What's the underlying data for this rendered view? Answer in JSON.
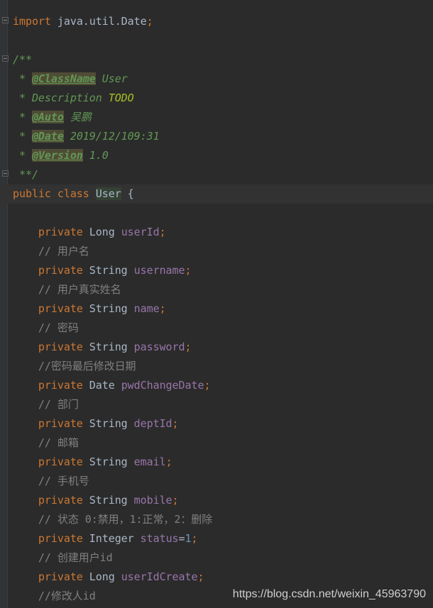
{
  "editor": {
    "theme_colors": {
      "background": "#2b2b2b",
      "keyword": "#cc7832",
      "field": "#9876aa",
      "comment": "#808080",
      "javadoc": "#629755",
      "todo": "#a8c023",
      "text": "#a9b7c6"
    },
    "current_line": 9,
    "fold_lines": [
      0,
      2,
      8
    ],
    "lines": [
      [
        [
          "kw",
          "import"
        ],
        [
          "pl",
          " java.util.Date"
        ],
        [
          "kw",
          ";"
        ]
      ],
      [],
      [
        [
          "jd",
          "/**"
        ]
      ],
      [
        [
          "jd",
          " * "
        ],
        [
          "tag",
          "@ClassName"
        ],
        [
          "jd",
          " User"
        ]
      ],
      [
        [
          "jd",
          " * Description "
        ],
        [
          "todo",
          "TODO"
        ]
      ],
      [
        [
          "jd",
          " * "
        ],
        [
          "tag",
          "@Auto"
        ],
        [
          "jd",
          " 吴鹏"
        ]
      ],
      [
        [
          "jd",
          " * "
        ],
        [
          "tag",
          "@Date"
        ],
        [
          "jd",
          " 2019/12/109:31"
        ]
      ],
      [
        [
          "jd",
          " * "
        ],
        [
          "tag",
          "@Version"
        ],
        [
          "jd",
          " 1.0"
        ]
      ],
      [
        [
          "jd",
          " **/"
        ]
      ],
      [
        [
          "kw",
          "public class "
        ],
        [
          "cls",
          "User"
        ],
        [
          "pl",
          " {"
        ]
      ],
      [],
      [
        [
          "kw",
          "    private "
        ],
        [
          "pl",
          "Long "
        ],
        [
          "fd",
          "userId"
        ],
        [
          "kw",
          ";"
        ]
      ],
      [
        [
          "cm",
          "    // 用户名"
        ]
      ],
      [
        [
          "kw",
          "    private "
        ],
        [
          "pl",
          "String "
        ],
        [
          "fd",
          "username"
        ],
        [
          "kw",
          ";"
        ]
      ],
      [
        [
          "cm",
          "    // 用户真实姓名"
        ]
      ],
      [
        [
          "kw",
          "    private "
        ],
        [
          "pl",
          "String "
        ],
        [
          "fd",
          "name"
        ],
        [
          "kw",
          ";"
        ]
      ],
      [
        [
          "cm",
          "    // 密码"
        ]
      ],
      [
        [
          "kw",
          "    private "
        ],
        [
          "pl",
          "String "
        ],
        [
          "fd",
          "password"
        ],
        [
          "kw",
          ";"
        ]
      ],
      [
        [
          "cm",
          "    //密码最后修改日期"
        ]
      ],
      [
        [
          "kw",
          "    private "
        ],
        [
          "pl",
          "Date "
        ],
        [
          "fd",
          "pwdChangeDate"
        ],
        [
          "kw",
          ";"
        ]
      ],
      [
        [
          "cm",
          "    // 部门"
        ]
      ],
      [
        [
          "kw",
          "    private "
        ],
        [
          "pl",
          "String "
        ],
        [
          "fd",
          "deptId"
        ],
        [
          "kw",
          ";"
        ]
      ],
      [
        [
          "cm",
          "    // 邮箱"
        ]
      ],
      [
        [
          "kw",
          "    private "
        ],
        [
          "pl",
          "String "
        ],
        [
          "fd",
          "email"
        ],
        [
          "kw",
          ";"
        ]
      ],
      [
        [
          "cm",
          "    // 手机号"
        ]
      ],
      [
        [
          "kw",
          "    private "
        ],
        [
          "pl",
          "String "
        ],
        [
          "fd",
          "mobile"
        ],
        [
          "kw",
          ";"
        ]
      ],
      [
        [
          "cm",
          "    // 状态 0:禁用，1:正常，2：删除"
        ]
      ],
      [
        [
          "kw",
          "    private "
        ],
        [
          "pl",
          "Integer "
        ],
        [
          "fd",
          "status"
        ],
        [
          "pl",
          "="
        ],
        [
          "num",
          "1"
        ],
        [
          "kw",
          ";"
        ]
      ],
      [
        [
          "cm",
          "    // 创建用户id"
        ]
      ],
      [
        [
          "kw",
          "    private "
        ],
        [
          "pl",
          "Long "
        ],
        [
          "fd",
          "userIdCreate"
        ],
        [
          "kw",
          ";"
        ]
      ],
      [
        [
          "cm",
          "    //修改人id"
        ]
      ]
    ]
  },
  "watermark": "https://blog.csdn.net/weixin_45963790"
}
